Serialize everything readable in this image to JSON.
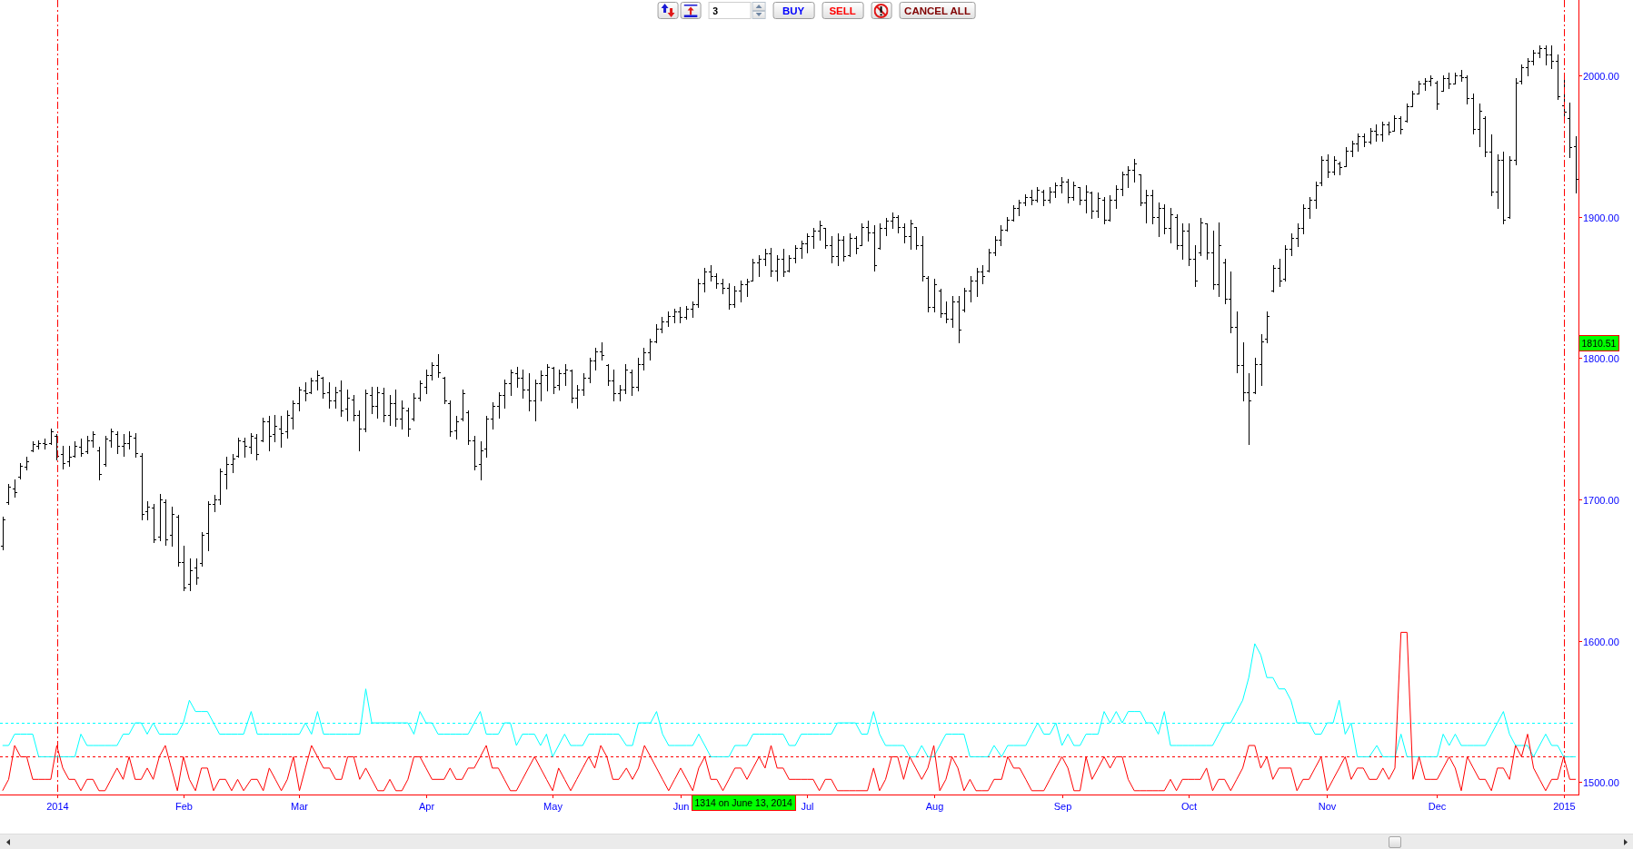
{
  "toolbar": {
    "items": [
      {
        "kind": "icon"
      },
      {
        "kind": "icon"
      },
      {
        "kind": "field",
        "value": "3"
      },
      {
        "kind": "text",
        "label": "BUY",
        "color": "#0000ff"
      },
      {
        "kind": "text",
        "label": "SELL",
        "color": "#ff0000"
      },
      {
        "kind": "icon"
      },
      {
        "kind": "text",
        "label": "CANCEL ALL",
        "color": "#800000"
      }
    ]
  },
  "price_chart": {
    "crosshair": {
      "price_label": "1810.51",
      "date_label": "1314 on June 13, 2014"
    },
    "chart_data": {
      "type": "line",
      "xlim": [
        2013.9623,
        2015.0098
      ],
      "ylim": [
        1491.3,
        2053.3
      ],
      "x": [
        2013.964,
        2013.968,
        2013.972,
        2013.976,
        2013.98,
        2013.984,
        2013.988,
        2013.992,
        2013.996,
        2014,
        2014.004,
        2014.008,
        2014.012,
        2014.016,
        2014.02,
        2014.024,
        2014.028,
        2014.032,
        2014.036,
        2014.04,
        2014.044,
        2014.048,
        2014.052,
        2014.056,
        2014.06,
        2014.064,
        2014.068,
        2014.072,
        2014.076,
        2014.08,
        2014.084,
        2014.088,
        2014.092,
        2014.096,
        2014.1,
        2014.104,
        2014.108,
        2014.112,
        2014.116,
        2014.12,
        2014.124,
        2014.129,
        2014.133,
        2014.137,
        2014.141,
        2014.145,
        2014.149,
        2014.153,
        2014.157,
        2014.161,
        2014.165,
        2014.169,
        2014.173,
        2014.177,
        2014.181,
        2014.185,
        2014.189,
        2014.193,
        2014.197,
        2014.201,
        2014.205,
        2014.209,
        2014.213,
        2014.217,
        2014.221,
        2014.225,
        2014.229,
        2014.233,
        2014.237,
        2014.241,
        2014.245,
        2014.249,
        2014.253,
        2014.257,
        2014.261,
        2014.265,
        2014.269,
        2014.273,
        2014.277,
        2014.281,
        2014.285,
        2014.289,
        2014.293,
        2014.297,
        2014.301,
        2014.305,
        2014.309,
        2014.313,
        2014.317,
        2014.321,
        2014.325,
        2014.329,
        2014.333,
        2014.337,
        2014.341,
        2014.345,
        2014.349,
        2014.353,
        2014.357,
        2014.361,
        2014.365,
        2014.369,
        2014.373,
        2014.378,
        2014.382,
        2014.386,
        2014.39,
        2014.394,
        2014.398,
        2014.402,
        2014.406,
        2014.41,
        2014.414,
        2014.418,
        2014.422,
        2014.426,
        2014.43,
        2014.434,
        2014.438,
        2014.442,
        2014.446,
        2014.45,
        2014.454,
        2014.458,
        2014.462,
        2014.466,
        2014.47,
        2014.474,
        2014.478,
        2014.482,
        2014.486,
        2014.49,
        2014.494,
        2014.498,
        2014.502,
        2014.506,
        2014.51,
        2014.514,
        2014.518,
        2014.522,
        2014.526,
        2014.53,
        2014.534,
        2014.538,
        2014.542,
        2014.546,
        2014.55,
        2014.554,
        2014.558,
        2014.562,
        2014.566,
        2014.57,
        2014.574,
        2014.578,
        2014.582,
        2014.586,
        2014.59,
        2014.594,
        2014.598,
        2014.602,
        2014.606,
        2014.61,
        2014.614,
        2014.618,
        2014.622,
        2014.627,
        2014.631,
        2014.635,
        2014.639,
        2014.643,
        2014.647,
        2014.651,
        2014.655,
        2014.659,
        2014.663,
        2014.667,
        2014.671,
        2014.675,
        2014.679,
        2014.683,
        2014.687,
        2014.691,
        2014.695,
        2014.699,
        2014.703,
        2014.707,
        2014.711,
        2014.715,
        2014.719,
        2014.723,
        2014.727,
        2014.731,
        2014.735,
        2014.739,
        2014.743,
        2014.747,
        2014.751,
        2014.755,
        2014.759,
        2014.763,
        2014.767,
        2014.771,
        2014.775,
        2014.779,
        2014.783,
        2014.787,
        2014.791,
        2014.795,
        2014.799,
        2014.803,
        2014.807,
        2014.811,
        2014.815,
        2014.819,
        2014.823,
        2014.827,
        2014.831,
        2014.835,
        2014.839,
        2014.843,
        2014.847,
        2014.851,
        2014.855,
        2014.859,
        2014.863,
        2014.867,
        2014.871,
        2014.876,
        2014.88,
        2014.884,
        2014.888,
        2014.892,
        2014.896,
        2014.9,
        2014.904,
        2014.908,
        2014.912,
        2014.916,
        2014.92,
        2014.924,
        2014.928,
        2014.932,
        2014.936,
        2014.94,
        2014.944,
        2014.948,
        2014.952,
        2014.956,
        2014.96,
        2014.964,
        2014.968,
        2014.972,
        2014.976,
        2014.98,
        2014.984,
        2014.988,
        2014.992,
        2014.996,
        2015,
        2015.004,
        2015.008
      ],
      "xticks": [
        {
          "value": 2014,
          "label": "2014"
        },
        {
          "value": 2014.084,
          "label": "Feb"
        },
        {
          "value": 2014.161,
          "label": "Mar"
        },
        {
          "value": 2014.245,
          "label": "Apr"
        },
        {
          "value": 2014.329,
          "label": "May"
        },
        {
          "value": 2014.414,
          "label": "Jun"
        },
        {
          "value": 2014.498,
          "label": "Jul"
        },
        {
          "value": 2014.582,
          "label": "Aug"
        },
        {
          "value": 2014.667,
          "label": "Sep"
        },
        {
          "value": 2014.751,
          "label": "Oct"
        },
        {
          "value": 2014.843,
          "label": "Nov"
        },
        {
          "value": 2014.916,
          "label": "Dec"
        },
        {
          "value": 2015,
          "label": "2015"
        }
      ],
      "yticks": [
        {
          "value": 1500,
          "label": "1500.00"
        },
        {
          "value": 1600,
          "label": "1600.00"
        },
        {
          "value": 1700,
          "label": "1700.00"
        },
        {
          "value": 1800,
          "label": "1800.00"
        },
        {
          "value": 1900,
          "label": "1900.00"
        },
        {
          "value": 2000,
          "label": "2000.00"
        }
      ],
      "series": [
        {
          "color": "#00ffff",
          "values": [
            1526,
            1526,
            1534,
            1534,
            1534,
            1534,
            1518,
            1518,
            1518,
            1518,
            1518,
            1518,
            1518,
            1534,
            1526,
            1526,
            1526,
            1526,
            1526,
            1526,
            1534,
            1534,
            1542,
            1542,
            1534,
            1542,
            1534,
            1534,
            1534,
            1534,
            1542,
            1558,
            1550,
            1550,
            1550,
            1542,
            1534,
            1534,
            1534,
            1534,
            1534,
            1550,
            1534,
            1534,
            1534,
            1534,
            1534,
            1534,
            1534,
            1534,
            1542,
            1534,
            1550,
            1534,
            1534,
            1534,
            1534,
            1534,
            1534,
            1534,
            1566,
            1542,
            1542,
            1542,
            1542,
            1542,
            1542,
            1542,
            1534,
            1550,
            1542,
            1542,
            1534,
            1534,
            1534,
            1534,
            1534,
            1534,
            1542,
            1550,
            1534,
            1534,
            1534,
            1542,
            1542,
            1526,
            1534,
            1534,
            1534,
            1526,
            1534,
            1518,
            1526,
            1534,
            1526,
            1526,
            1526,
            1534,
            1534,
            1534,
            1534,
            1534,
            1534,
            1526,
            1526,
            1542,
            1542,
            1542,
            1550,
            1534,
            1526,
            1526,
            1526,
            1526,
            1526,
            1534,
            1526,
            1518,
            1518,
            1518,
            1518,
            1526,
            1526,
            1526,
            1534,
            1534,
            1534,
            1534,
            1534,
            1534,
            1526,
            1526,
            1534,
            1534,
            1534,
            1534,
            1534,
            1534,
            1542,
            1542,
            1542,
            1542,
            1534,
            1534,
            1550,
            1534,
            1526,
            1526,
            1526,
            1526,
            1518,
            1518,
            1526,
            1518,
            1518,
            1526,
            1534,
            1534,
            1534,
            1534,
            1518,
            1518,
            1518,
            1518,
            1526,
            1518,
            1526,
            1526,
            1526,
            1526,
            1534,
            1542,
            1534,
            1534,
            1542,
            1526,
            1534,
            1526,
            1526,
            1534,
            1534,
            1534,
            1550,
            1542,
            1550,
            1542,
            1550,
            1550,
            1550,
            1542,
            1542,
            1534,
            1550,
            1526,
            1526,
            1526,
            1526,
            1526,
            1526,
            1526,
            1526,
            1534,
            1542,
            1542,
            1550,
            1558,
            1574,
            1598,
            1590,
            1574,
            1574,
            1566,
            1566,
            1558,
            1542,
            1542,
            1542,
            1534,
            1534,
            1542,
            1542,
            1558,
            1534,
            1542,
            1518,
            1518,
            1518,
            1526,
            1518,
            1518,
            1518,
            1534,
            1518,
            1518,
            1518,
            1518,
            1518,
            1518,
            1534,
            1526,
            1534,
            1526,
            1526,
            1526,
            1526,
            1526,
            1534,
            1542,
            1550,
            1534,
            1526,
            1526,
            1526,
            1518,
            1526,
            1534,
            1526,
            1526,
            1518,
            1518,
            1518
          ]
        },
        {
          "color": "#ff0000",
          "values": [
            1494,
            1502,
            1526,
            1518,
            1518,
            1502,
            1502,
            1502,
            1502,
            1526,
            1510,
            1502,
            1502,
            1494,
            1502,
            1502,
            1494,
            1494,
            1502,
            1510,
            1502,
            1518,
            1502,
            1502,
            1510,
            1502,
            1518,
            1526,
            1510,
            1494,
            1518,
            1502,
            1494,
            1510,
            1510,
            1494,
            1502,
            1502,
            1494,
            1502,
            1494,
            1502,
            1502,
            1494,
            1510,
            1502,
            1494,
            1502,
            1518,
            1494,
            1510,
            1526,
            1518,
            1510,
            1510,
            1502,
            1502,
            1518,
            1518,
            1502,
            1510,
            1502,
            1494,
            1494,
            1502,
            1494,
            1494,
            1502,
            1518,
            1518,
            1510,
            1502,
            1502,
            1502,
            1510,
            1502,
            1502,
            1510,
            1510,
            1518,
            1526,
            1510,
            1510,
            1502,
            1494,
            1494,
            1502,
            1510,
            1518,
            1510,
            1502,
            1494,
            1510,
            1502,
            1494,
            1502,
            1510,
            1518,
            1510,
            1526,
            1518,
            1502,
            1502,
            1510,
            1502,
            1510,
            1526,
            1518,
            1510,
            1502,
            1494,
            1502,
            1510,
            1502,
            1494,
            1510,
            1518,
            1502,
            1502,
            1494,
            1502,
            1510,
            1510,
            1502,
            1510,
            1518,
            1510,
            1526,
            1510,
            1510,
            1502,
            1502,
            1502,
            1502,
            1502,
            1494,
            1502,
            1502,
            1494,
            1494,
            1494,
            1494,
            1494,
            1494,
            1510,
            1494,
            1502,
            1518,
            1518,
            1502,
            1518,
            1510,
            1502,
            1510,
            1526,
            1494,
            1502,
            1518,
            1510,
            1494,
            1502,
            1494,
            1494,
            1494,
            1502,
            1502,
            1518,
            1510,
            1510,
            1502,
            1494,
            1494,
            1494,
            1502,
            1510,
            1518,
            1510,
            1494,
            1494,
            1518,
            1502,
            1510,
            1518,
            1510,
            1518,
            1518,
            1502,
            1494,
            1494,
            1494,
            1494,
            1494,
            1494,
            1502,
            1494,
            1502,
            1502,
            1502,
            1502,
            1510,
            1494,
            1502,
            1502,
            1494,
            1502,
            1510,
            1526,
            1526,
            1510,
            1518,
            1502,
            1510,
            1510,
            1510,
            1494,
            1502,
            1502,
            1510,
            1518,
            1494,
            1502,
            1510,
            1518,
            1502,
            1510,
            1510,
            1502,
            1502,
            1510,
            1502,
            1510,
            1606,
            1606,
            1502,
            1518,
            1502,
            1502,
            1502,
            1510,
            1518,
            1510,
            1494,
            1518,
            1510,
            1502,
            1502,
            1494,
            1510,
            1510,
            1502,
            1526,
            1518,
            1534,
            1510,
            1502,
            1494,
            1502,
            1502,
            1518,
            1502,
            1502
          ]
        }
      ],
      "ref_lines": [
        {
          "axis": "y",
          "value": 1542,
          "color": "#00ffff"
        },
        {
          "axis": "y",
          "value": 1518,
          "color": "#ff0000"
        },
        {
          "axis": "x",
          "value": 2014,
          "color": "#ff0000"
        },
        {
          "axis": "x",
          "value": 2015,
          "color": "#ff0000"
        }
      ]
    }
  }
}
